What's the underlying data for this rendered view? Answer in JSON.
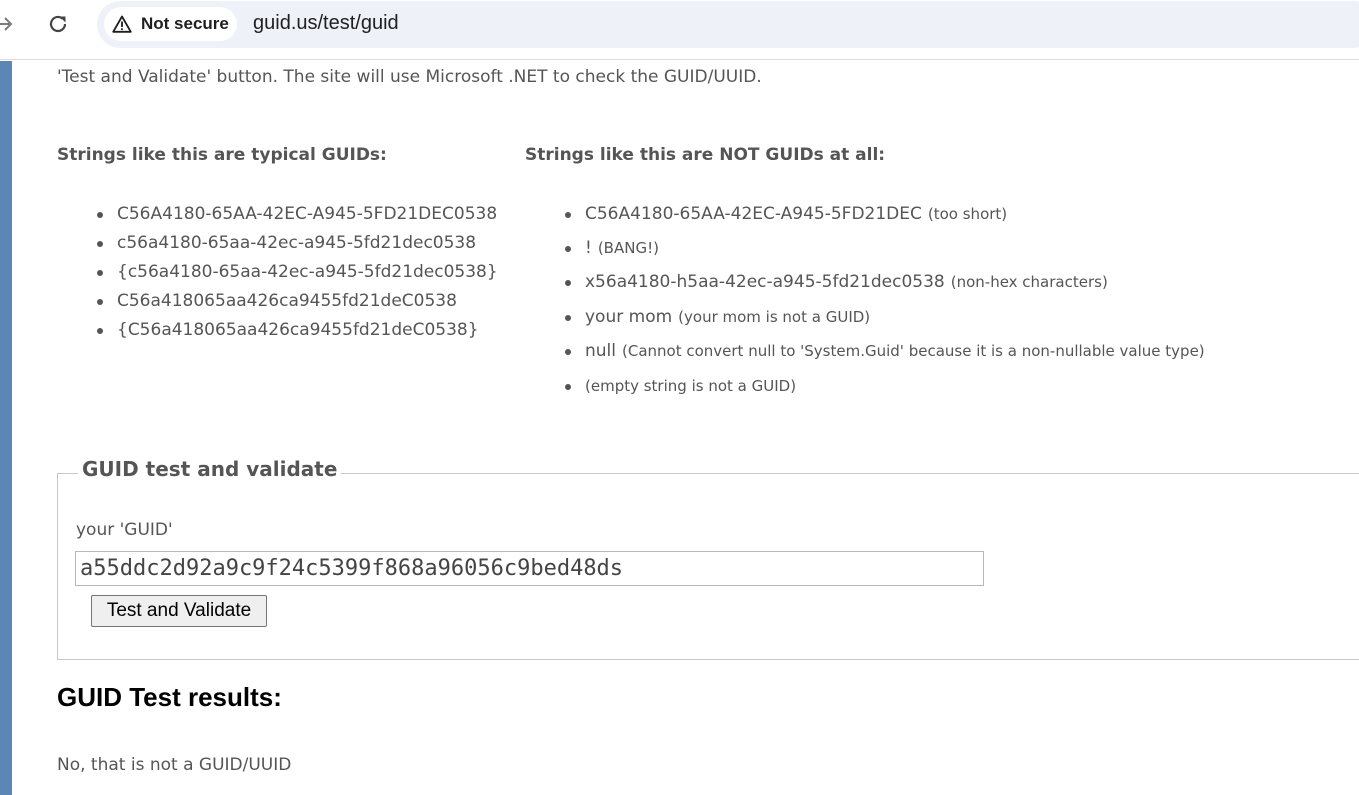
{
  "browser": {
    "security_label": "Not secure",
    "url": "guid.us/test/guid",
    "icons": [
      "forward-arrow-icon",
      "reload-icon",
      "warning-triangle-icon"
    ]
  },
  "page": {
    "intro_text": "'Test and Validate' button. The site will use Microsoft .NET to check the GUID/UUID.",
    "valid_heading": "Strings like this are typical GUIDs:",
    "valid_examples": [
      "C56A4180-65AA-42EC-A945-5FD21DEC0538",
      "c56a4180-65aa-42ec-a945-5fd21dec0538",
      "{c56a4180-65aa-42ec-a945-5fd21dec0538}",
      "C56a418065aa426ca9455fd21deC0538",
      "{C56a418065aa426ca9455fd21deC0538}"
    ],
    "invalid_heading": "Strings like this are NOT GUIDs at all:",
    "invalid_examples": [
      {
        "value": "C56A4180-65AA-42EC-A945-5FD21DEC",
        "note": "(too short)"
      },
      {
        "value": "!",
        "note": "(BANG!)"
      },
      {
        "value": "x56a4180-h5aa-42ec-a945-5fd21dec0538",
        "note": "(non-hex characters)"
      },
      {
        "value": "your mom",
        "note": "(your mom is not a GUID)"
      },
      {
        "value": "null",
        "note": "(Cannot convert null to 'System.Guid' because it is a non-nullable value type)"
      },
      {
        "value": "",
        "note": "(empty string is not a GUID)"
      }
    ],
    "form": {
      "legend": "GUID test and validate",
      "field_label": "your 'GUID'",
      "field_value": "a55ddc2d92a9c9f24c5399f868a96056c9bed48ds",
      "button_label": "Test and Validate"
    },
    "results_title": "GUID Test results:",
    "result_text": "No, that is not a GUID/UUID"
  },
  "colors": {
    "left_bar": "#5b86b5",
    "text": "#555555",
    "omnibox": "#eef1f8"
  }
}
